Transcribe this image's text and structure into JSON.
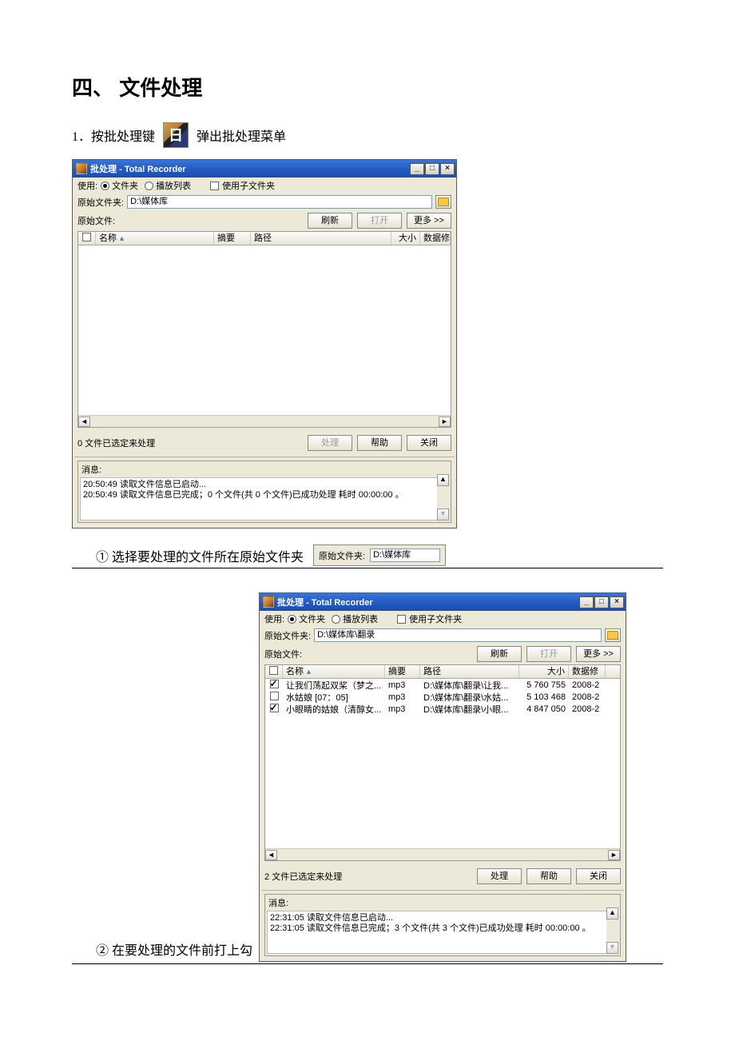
{
  "doc": {
    "heading": "四、 文件处理",
    "intro_prefix": "1．按批处理键",
    "intro_suffix": "弹出批处理菜单",
    "step1": "①  选择要处理的文件所在原始文件夹",
    "step2": "②  在要处理的文件前打上勾"
  },
  "snippet": {
    "label": "原始文件夹:",
    "value": "D:\\媒体库"
  },
  "common_labels": {
    "use": "使用:",
    "radio_folder": "文件夹",
    "radio_playlist": "播放列表",
    "chk_subfolder": "使用子文件夹",
    "src_folder": "原始文件夹:",
    "src_files": "原始文件:",
    "btn_refresh": "刷新",
    "btn_open": "打开",
    "btn_more": "更多 >>",
    "col_name": "名称",
    "col_summary": "摘要",
    "col_path": "路径",
    "col_size": "大小",
    "col_data": "数据修",
    "btn_process": "处理",
    "btn_help": "帮助",
    "btn_close": "关闭",
    "msg_label": "消息:"
  },
  "win1": {
    "title": "批处理 - Total Recorder",
    "folder_path": "D:\\媒体库",
    "status_line": "0 文件已选定来处理",
    "messages": "20:50:49 读取文件信息已启动...\n20:50:49 读取文件信息已完成；0 个文件(共 0 个文件)已成功处理 耗时 00:00:00 。"
  },
  "win2": {
    "title": "批处理 - Total Recorder",
    "folder_path": "D:\\媒体库\\翻录",
    "status_line": "2 文件已选定来处理",
    "rows": [
      {
        "checked": true,
        "name": "让我们荡起双桨（梦之...",
        "summary": "mp3",
        "path": "D:\\媒体库\\翻录\\让我...",
        "size": "5 760 755",
        "data": "2008-2"
      },
      {
        "checked": false,
        "name": "水姑娘 [07：05]",
        "summary": "mp3",
        "path": "D:\\媒体库\\翻录\\水姑...",
        "size": "5 103 468",
        "data": "2008-2"
      },
      {
        "checked": true,
        "name": "小眼睛的姑娘（清醇女...",
        "summary": "mp3",
        "path": "D:\\媒体库\\翻录\\小眼...",
        "size": "4 847 050",
        "data": "2008-2"
      }
    ],
    "messages": "22:31:05 读取文件信息已启动...\n22:31:05 读取文件信息已完成；3 个文件(共 3 个文件)已成功处理 耗时 00:00:00 。"
  }
}
